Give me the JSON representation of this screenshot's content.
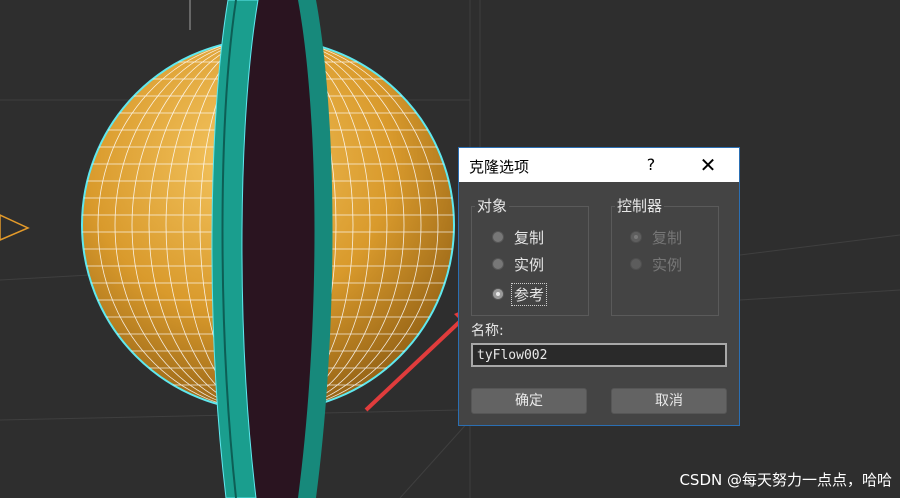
{
  "dialog": {
    "title": "克隆选项",
    "help_label": "?",
    "close_label": "✕",
    "object_group": {
      "label": "对象",
      "options": [
        {
          "label": "复制",
          "checked": false
        },
        {
          "label": "实例",
          "checked": false
        },
        {
          "label": "参考",
          "checked": true
        }
      ]
    },
    "controller_group": {
      "label": "控制器",
      "options": [
        {
          "label": "复制",
          "checked": true,
          "disabled": true
        },
        {
          "label": "实例",
          "checked": false,
          "disabled": true
        }
      ]
    },
    "name_label": "名称:",
    "name_value": "tyFlow002",
    "ok_label": "确定",
    "cancel_label": "取消"
  },
  "watermark": "CSDN @每天努力一点点，哈哈",
  "colors": {
    "accent": "#2b6fb3",
    "arrow": "#e03c3c",
    "sphere": "#e0a238",
    "ring": "#1a9e8e",
    "selection": "#5fe8ef"
  }
}
